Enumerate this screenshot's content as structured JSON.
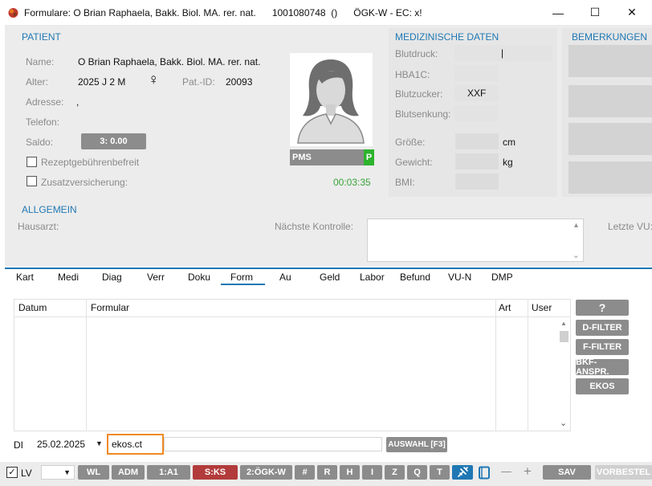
{
  "window": {
    "title": "Formulare: O Brian Raphaela, Bakk. Biol. MA. rer. nat.",
    "patient_number": "1001080748",
    "parens": "()",
    "insurance": "ÖGK-W - EC: x!",
    "min_glyph": "—",
    "max_glyph": "☐",
    "close_glyph": "✕"
  },
  "patient": {
    "section_title": "PATIENT",
    "name_label": "Name:",
    "name_value": "O Brian Raphaela, Bakk. Biol. MA. rer. nat.",
    "alter_label": "Alter:",
    "alter_value": "2025 J 2 M",
    "gender_glyph": "♀",
    "patid_label": "Pat.-ID:",
    "patid_value": "20093",
    "adresse_label": "Adresse:",
    "adresse_value": ",",
    "telefon_label": "Telefon:",
    "saldo_label": "Saldo:",
    "saldo_value": "3: 0.00",
    "rezept_label": "Rezeptgebührenbefreit",
    "zusatz_label": "Zusatzversicherung:",
    "pms_label": "PMS",
    "pms_flag": "P",
    "timer": "00:03:35"
  },
  "medical": {
    "section_title": "MEDIZINISCHE DATEN",
    "blutdruck_label": "Blutdruck:",
    "blutdruck_value": "|",
    "hba1c_label": "HBA1C:",
    "blutzucker_label": "Blutzucker:",
    "blutzucker_value": "XXF",
    "blutsenkung_label": "Blutsenkung:",
    "groesse_label": "Größe:",
    "groesse_unit": "cm",
    "gewicht_label": "Gewicht:",
    "gewicht_unit": "kg",
    "bmi_label": "BMI:"
  },
  "bemerkungen": {
    "section_title": "BEMERKUNGEN"
  },
  "allgemein": {
    "section_title": "ALLGEMEIN",
    "hausarzt_label": "Hausarzt:",
    "kontrolle_label": "Nächste Kontrolle:",
    "letzte_label": "Letzte VU:"
  },
  "tabs": [
    "Kart",
    "Medi",
    "Diag",
    "Verr",
    "Doku",
    "Form",
    "Au",
    "Geld",
    "Labor",
    "Befund",
    "VU-N",
    "DMP"
  ],
  "table": {
    "columns": [
      "Datum",
      "Formular",
      "Art",
      "User"
    ],
    "scroll_up": "▲",
    "scroll_down": "⌄"
  },
  "side_buttons": [
    "?",
    "D-FILTER",
    "F-FILTER",
    "BKF-ANSPR.",
    "EKOS"
  ],
  "entry": {
    "di_label": "DI",
    "date_value": "25.02.2025",
    "date_caret": "▼",
    "formular_value": "ekos.ct",
    "auswahl_label": "AUSWAHL [F3]"
  },
  "bottom": {
    "lv_label": "LV",
    "lv_check": "✓",
    "select_caret": "▼",
    "buttons": [
      "WL",
      "ADM",
      "1:A1",
      "S:KS",
      "2:ÖGK-W",
      "#",
      "R",
      "H",
      "I",
      "Z",
      "Q",
      "T"
    ],
    "minus": "—",
    "plus": "+",
    "sav_label": "SAV",
    "vorbestel_label": "VORBESTEL"
  },
  "colors": {
    "accent": "#1f78b4",
    "button_gray": "#8c8c8c",
    "active_red": "#b23b3b",
    "focus_orange": "#f08a24",
    "pms_green": "#2db32d",
    "timer_green": "#3aa33a"
  }
}
